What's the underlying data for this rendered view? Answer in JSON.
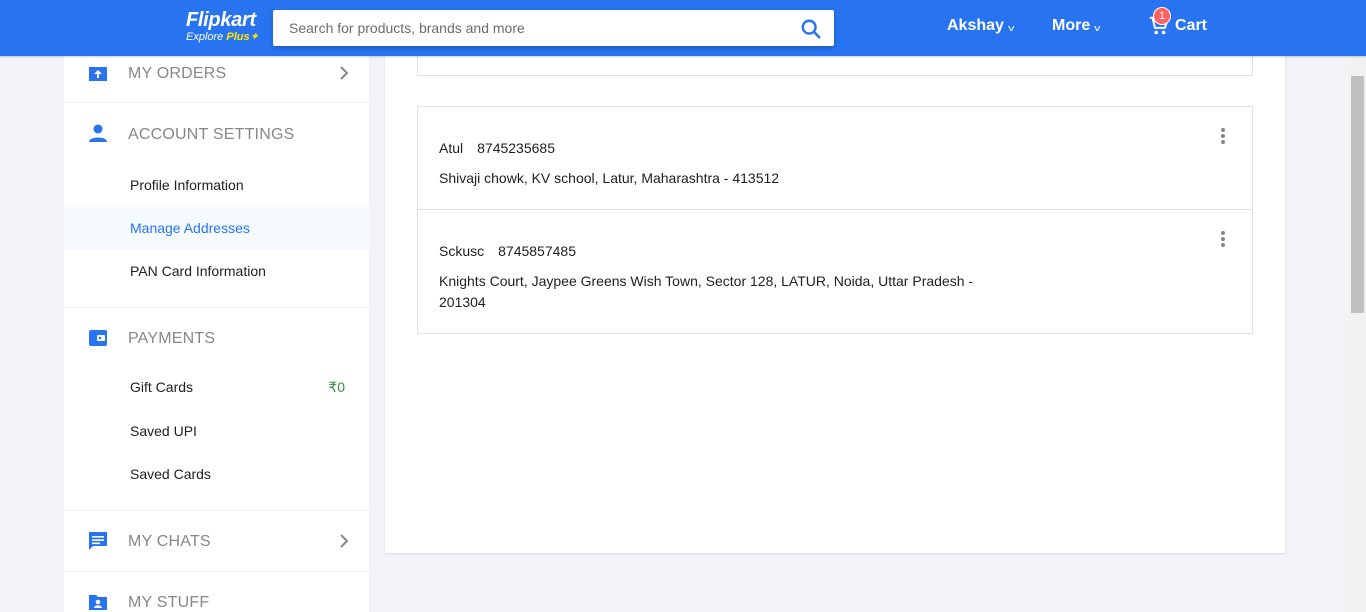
{
  "header": {
    "logo_main": "Flipkart",
    "logo_sub_explore": "Explore",
    "logo_sub_plus": "Plus",
    "search_placeholder": "Search for products, brands and more",
    "user_name": "Akshay",
    "more_label": "More",
    "cart_label": "Cart",
    "cart_count": "1",
    "brand_color": "#2874f0"
  },
  "sidebar": {
    "my_orders": "MY ORDERS",
    "account_settings": {
      "title": "ACCOUNT SETTINGS",
      "items": [
        "Profile Information",
        "Manage Addresses",
        "PAN Card Information"
      ],
      "active_index": 1
    },
    "payments": {
      "title": "PAYMENTS",
      "items": [
        "Gift Cards",
        "Saved UPI",
        "Saved Cards"
      ],
      "gift_card_balance": "₹0"
    },
    "my_chats": "MY CHATS",
    "my_stuff": "MY STUFF"
  },
  "addresses": [
    {
      "name": "Atul",
      "phone": "8745235685",
      "address": "Shivaji chowk, KV school, Latur, Maharashtra - 413512"
    },
    {
      "name": "Sckusc",
      "phone": "8745857485",
      "address": "Knights Court, Jaypee Greens Wish Town, Sector 128, LATUR, Noida, Uttar Pradesh - 201304"
    }
  ]
}
